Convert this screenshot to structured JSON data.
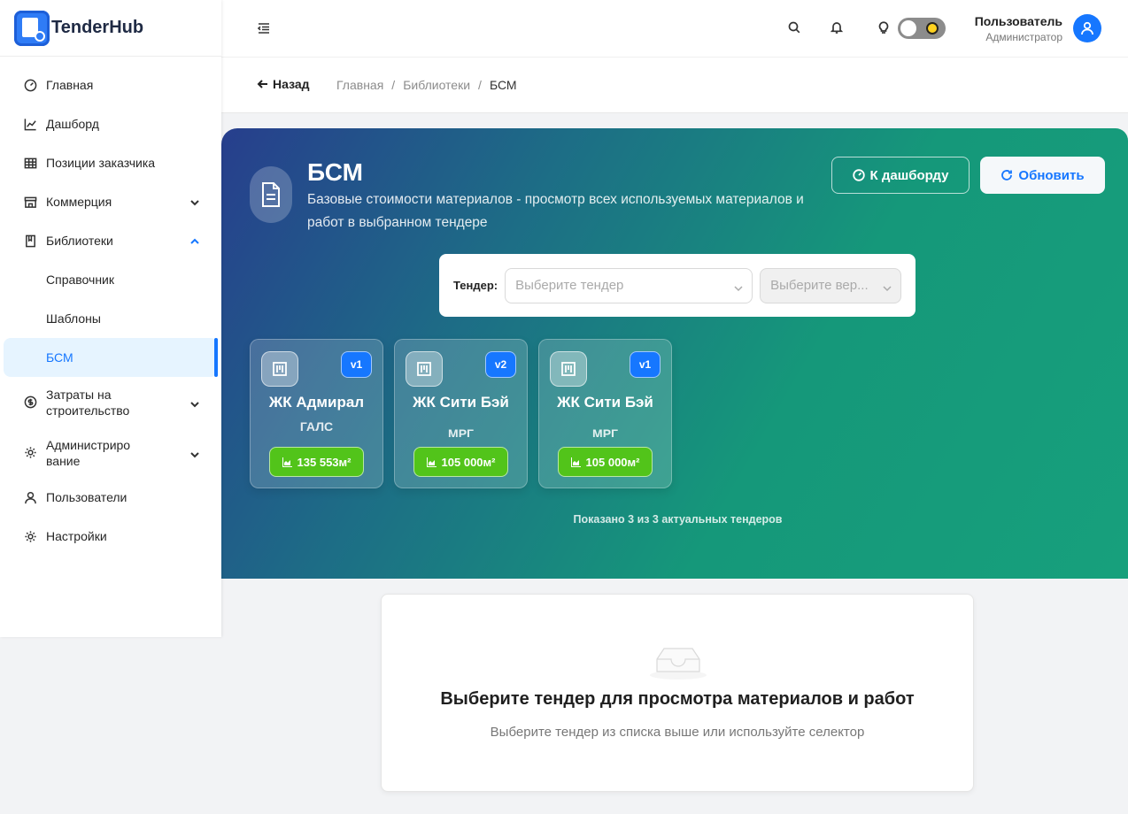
{
  "app": {
    "name": "TenderHub"
  },
  "sidebar": {
    "items": [
      {
        "label": "Главная"
      },
      {
        "label": "Дашборд"
      },
      {
        "label": "Позиции заказчика"
      },
      {
        "label": "Коммерция"
      },
      {
        "label": "Библиотеки"
      },
      {
        "label": "Справочник"
      },
      {
        "label": "Шаблоны"
      },
      {
        "label": "БСМ"
      },
      {
        "label": "Затраты на строительство"
      },
      {
        "label": "Администрирование"
      },
      {
        "label": "Пользователи"
      },
      {
        "label": "Настройки"
      }
    ],
    "two_line": {
      "costs_line1": "Затраты на",
      "costs_line2": "строительство",
      "admin_line1": "Администриро",
      "admin_line2": "вание"
    }
  },
  "header": {
    "user_name": "Пользователь",
    "user_role": "Администратор"
  },
  "breadcrumb": {
    "back_label": "Назад",
    "items": [
      "Главная",
      "Библиотеки",
      "БСМ"
    ],
    "separator": "/"
  },
  "hero": {
    "title": "БСМ",
    "description": "Базовые стоимости материалов - просмотр всех используемых материалов и работ в выбранном тендере",
    "dashboard_button": "К дашборду",
    "refresh_button": "Обновить",
    "selector": {
      "label": "Тендер:",
      "tender_placeholder": "Выберите тендер",
      "version_placeholder": "Выберите вер..."
    },
    "cards": [
      {
        "name": "ЖК Адмирал",
        "subtitle": "ГАЛС",
        "version": "v1",
        "area": "135 553м²"
      },
      {
        "name": "ЖК Сити Бэй",
        "subtitle": "МРГ",
        "version": "v2",
        "area": "105 000м²"
      },
      {
        "name": "ЖК Сити Бэй",
        "subtitle": "МРГ",
        "version": "v1",
        "area": "105 000м²"
      }
    ],
    "shown_text": "Показано 3 из 3 актуальных тендеров"
  },
  "empty_state": {
    "title": "Выберите тендер для просмотра материалов и работ",
    "subtitle": "Выберите тендер из списка выше или используйте селектор"
  },
  "colors": {
    "accent": "#1677ff",
    "success": "#52c41a"
  }
}
